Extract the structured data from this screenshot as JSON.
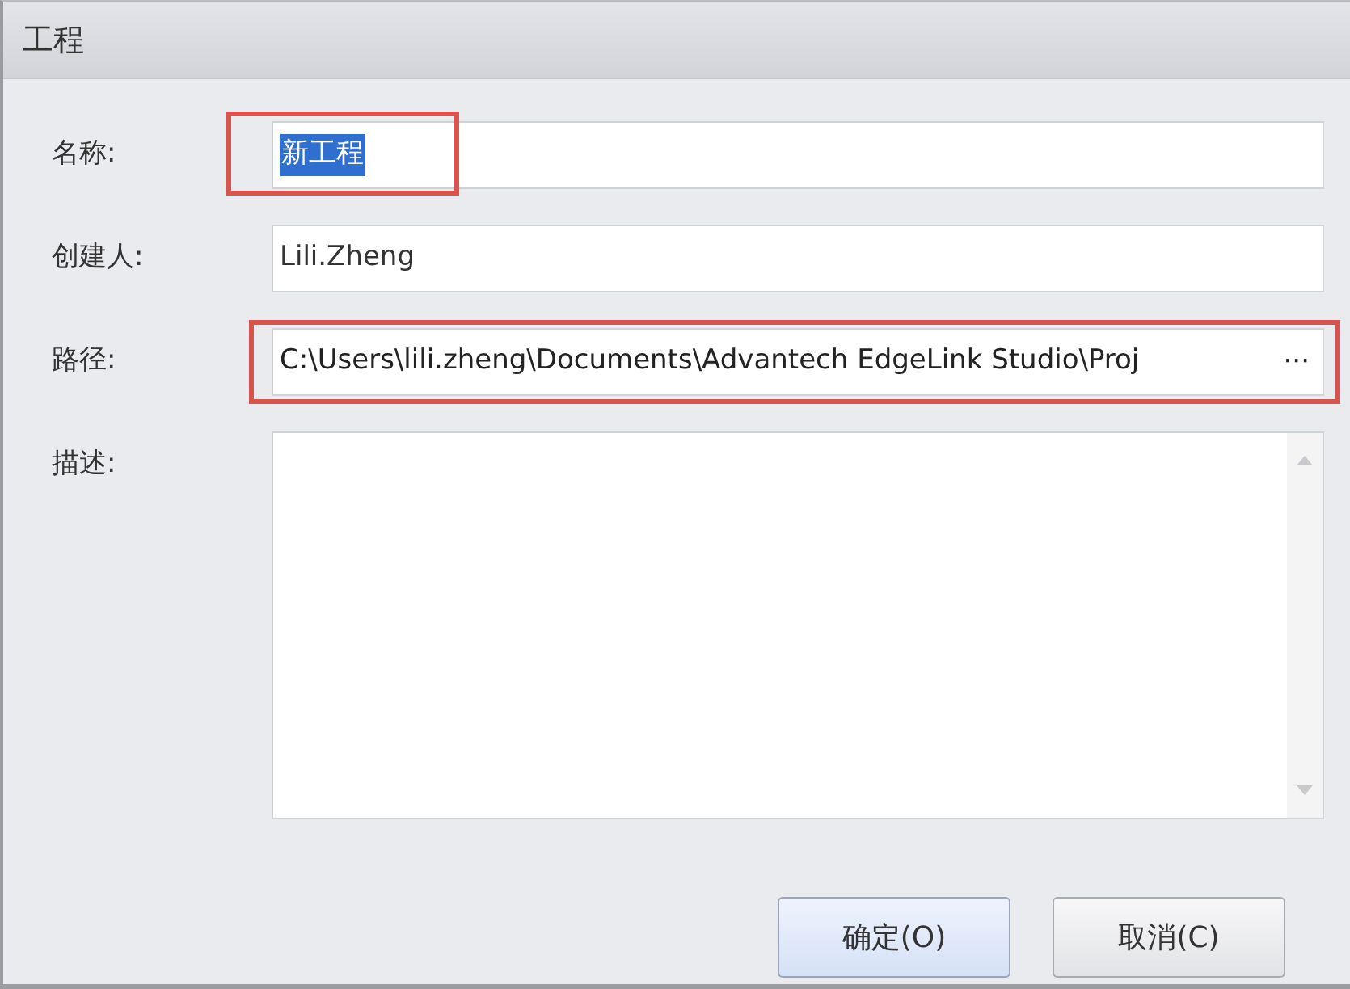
{
  "window": {
    "title": "工程"
  },
  "fields": [
    {
      "kind": "text",
      "label": "名称:",
      "value": "新工程",
      "text_selected": true,
      "highlighted": true
    },
    {
      "kind": "text",
      "label": "创建人:",
      "value": "Lili.Zheng",
      "text_selected": false,
      "highlighted": false
    },
    {
      "kind": "browse",
      "label": "路径:",
      "value": "C:\\Users\\lili.zheng\\Documents\\Advantech EdgeLink Studio\\Proj",
      "browse_button": "···",
      "highlighted": true
    },
    {
      "kind": "memo",
      "label": "描述:",
      "highlighted": false
    }
  ],
  "buttons": [
    {
      "label": "确定(O)",
      "default": true
    },
    {
      "label": "取消(C)",
      "default": false
    }
  ]
}
